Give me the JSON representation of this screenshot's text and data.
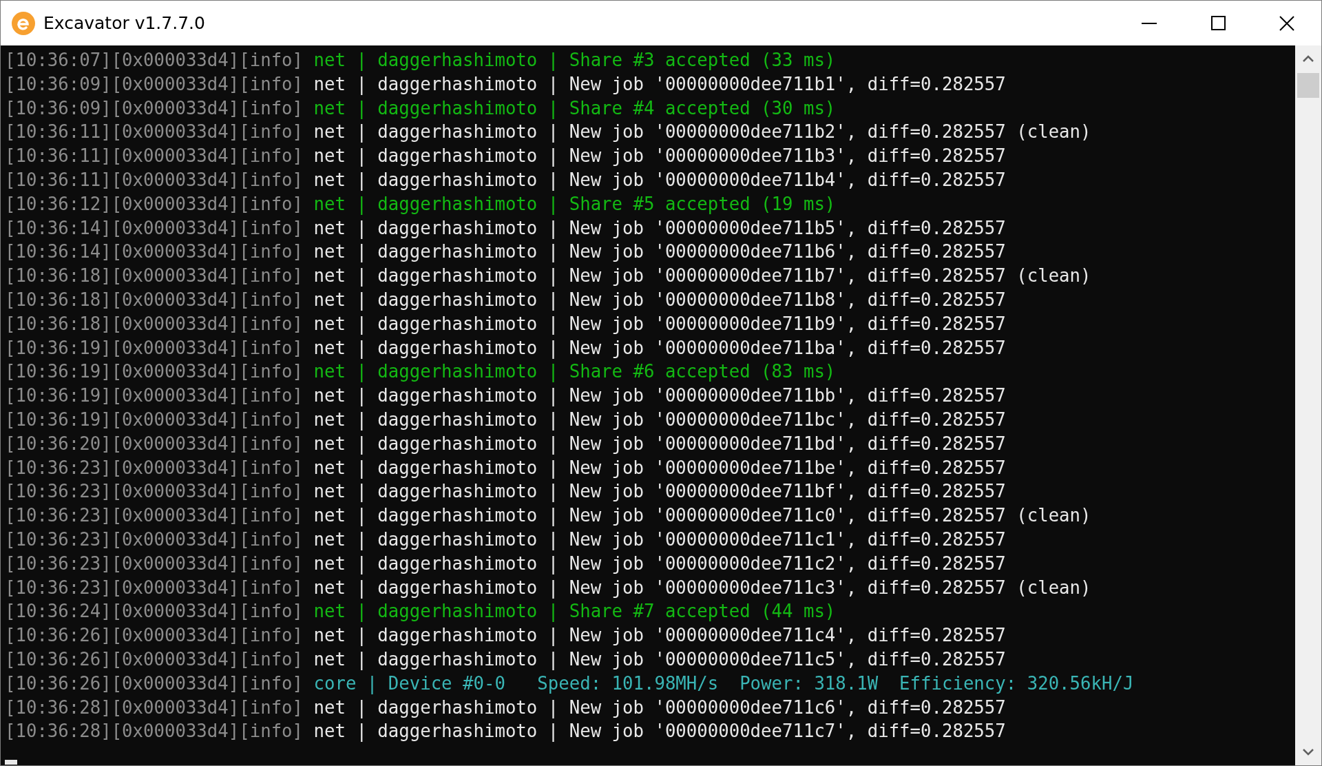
{
  "window": {
    "title": "Excavator v1.7.7.0"
  },
  "console": {
    "cursor": true,
    "lines": [
      {
        "kind": "share",
        "prefix": "[10:36:07][0x000033d4][info]",
        "message": "net | daggerhashimoto | Share #3 accepted (33 ms)"
      },
      {
        "kind": "job",
        "prefix": "[10:36:09][0x000033d4][info]",
        "message": "net | daggerhashimoto | New job '00000000dee711b1', diff=0.282557"
      },
      {
        "kind": "share",
        "prefix": "[10:36:09][0x000033d4][info]",
        "message": "net | daggerhashimoto | Share #4 accepted (30 ms)"
      },
      {
        "kind": "job",
        "prefix": "[10:36:11][0x000033d4][info]",
        "message": "net | daggerhashimoto | New job '00000000dee711b2', diff=0.282557 (clean)"
      },
      {
        "kind": "job",
        "prefix": "[10:36:11][0x000033d4][info]",
        "message": "net | daggerhashimoto | New job '00000000dee711b3', diff=0.282557"
      },
      {
        "kind": "job",
        "prefix": "[10:36:11][0x000033d4][info]",
        "message": "net | daggerhashimoto | New job '00000000dee711b4', diff=0.282557"
      },
      {
        "kind": "share",
        "prefix": "[10:36:12][0x000033d4][info]",
        "message": "net | daggerhashimoto | Share #5 accepted (19 ms)"
      },
      {
        "kind": "job",
        "prefix": "[10:36:14][0x000033d4][info]",
        "message": "net | daggerhashimoto | New job '00000000dee711b5', diff=0.282557"
      },
      {
        "kind": "job",
        "prefix": "[10:36:14][0x000033d4][info]",
        "message": "net | daggerhashimoto | New job '00000000dee711b6', diff=0.282557"
      },
      {
        "kind": "job",
        "prefix": "[10:36:18][0x000033d4][info]",
        "message": "net | daggerhashimoto | New job '00000000dee711b7', diff=0.282557 (clean)"
      },
      {
        "kind": "job",
        "prefix": "[10:36:18][0x000033d4][info]",
        "message": "net | daggerhashimoto | New job '00000000dee711b8', diff=0.282557"
      },
      {
        "kind": "job",
        "prefix": "[10:36:18][0x000033d4][info]",
        "message": "net | daggerhashimoto | New job '00000000dee711b9', diff=0.282557"
      },
      {
        "kind": "job",
        "prefix": "[10:36:19][0x000033d4][info]",
        "message": "net | daggerhashimoto | New job '00000000dee711ba', diff=0.282557"
      },
      {
        "kind": "share",
        "prefix": "[10:36:19][0x000033d4][info]",
        "message": "net | daggerhashimoto | Share #6 accepted (83 ms)"
      },
      {
        "kind": "job",
        "prefix": "[10:36:19][0x000033d4][info]",
        "message": "net | daggerhashimoto | New job '00000000dee711bb', diff=0.282557"
      },
      {
        "kind": "job",
        "prefix": "[10:36:19][0x000033d4][info]",
        "message": "net | daggerhashimoto | New job '00000000dee711bc', diff=0.282557"
      },
      {
        "kind": "job",
        "prefix": "[10:36:20][0x000033d4][info]",
        "message": "net | daggerhashimoto | New job '00000000dee711bd', diff=0.282557"
      },
      {
        "kind": "job",
        "prefix": "[10:36:23][0x000033d4][info]",
        "message": "net | daggerhashimoto | New job '00000000dee711be', diff=0.282557"
      },
      {
        "kind": "job",
        "prefix": "[10:36:23][0x000033d4][info]",
        "message": "net | daggerhashimoto | New job '00000000dee711bf', diff=0.282557"
      },
      {
        "kind": "job",
        "prefix": "[10:36:23][0x000033d4][info]",
        "message": "net | daggerhashimoto | New job '00000000dee711c0', diff=0.282557 (clean)"
      },
      {
        "kind": "job",
        "prefix": "[10:36:23][0x000033d4][info]",
        "message": "net | daggerhashimoto | New job '00000000dee711c1', diff=0.282557"
      },
      {
        "kind": "job",
        "prefix": "[10:36:23][0x000033d4][info]",
        "message": "net | daggerhashimoto | New job '00000000dee711c2', diff=0.282557"
      },
      {
        "kind": "job",
        "prefix": "[10:36:23][0x000033d4][info]",
        "message": "net | daggerhashimoto | New job '00000000dee711c3', diff=0.282557 (clean)"
      },
      {
        "kind": "share",
        "prefix": "[10:36:24][0x000033d4][info]",
        "message": "net | daggerhashimoto | Share #7 accepted (44 ms)"
      },
      {
        "kind": "job",
        "prefix": "[10:36:26][0x000033d4][info]",
        "message": "net | daggerhashimoto | New job '00000000dee711c4', diff=0.282557"
      },
      {
        "kind": "job",
        "prefix": "[10:36:26][0x000033d4][info]",
        "message": "net | daggerhashimoto | New job '00000000dee711c5', diff=0.282557"
      },
      {
        "kind": "core",
        "prefix": "[10:36:26][0x000033d4][info]",
        "message": "core | Device #0-0   Speed: 101.98MH/s  Power: 318.1W  Efficiency: 320.56kH/J"
      },
      {
        "kind": "job",
        "prefix": "[10:36:28][0x000033d4][info]",
        "message": "net | daggerhashimoto | New job '00000000dee711c6', diff=0.282557"
      },
      {
        "kind": "job",
        "prefix": "[10:36:28][0x000033d4][info]",
        "message": "net | daggerhashimoto | New job '00000000dee711c7', diff=0.282557"
      }
    ]
  }
}
